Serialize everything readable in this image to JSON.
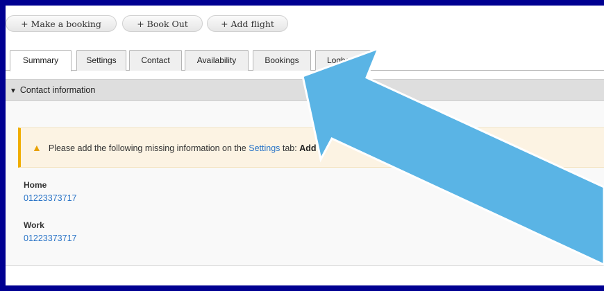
{
  "toolbar": {
    "make_booking": "+ Make a booking",
    "book_out": "+ Book Out",
    "add_flight": "+ Add flight"
  },
  "tabs": [
    {
      "label": "Summary",
      "active": true
    },
    {
      "label": "Settings",
      "active": false
    },
    {
      "label": "Contact",
      "active": false
    },
    {
      "label": "Availability",
      "active": false
    },
    {
      "label": "Bookings",
      "active": false
    },
    {
      "label": "Logbook",
      "active": false
    }
  ],
  "section": {
    "title": "Contact information",
    "toggle_icon": "triangle-down-icon"
  },
  "alert": {
    "icon": "warning-icon",
    "text_before": "Please add the following missing information on the ",
    "link_text": "Settings",
    "text_after": " tab: ",
    "missing": "Add"
  },
  "contacts": [
    {
      "label": "Home",
      "value": "01223373717"
    },
    {
      "label": "Work",
      "value": "01223373717"
    }
  ],
  "colors": {
    "frame_border": "#000091",
    "arrow": "#5ab4e5",
    "link": "#2a74c7",
    "warning": "#f0ad00"
  }
}
